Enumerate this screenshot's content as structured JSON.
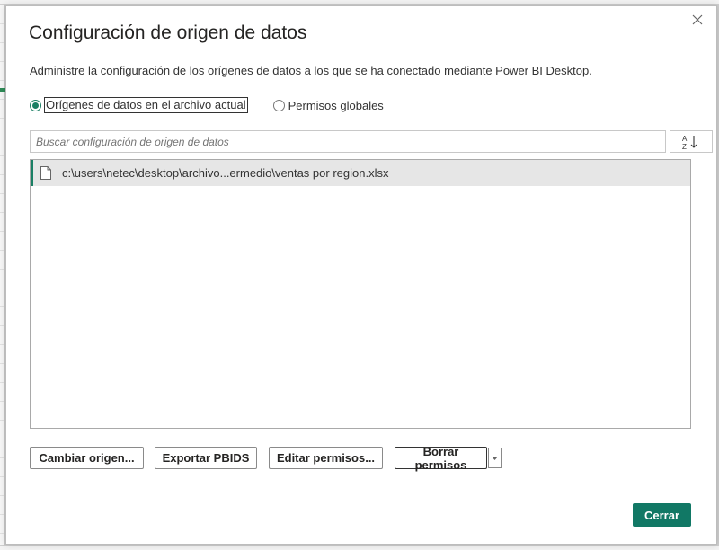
{
  "dialog": {
    "title": "Configuración de origen de datos",
    "description": "Administre la configuración de los orígenes de datos a los que se ha conectado mediante Power BI Desktop.",
    "close_icon": "close-icon"
  },
  "scope": {
    "options": [
      {
        "label": "Orígenes de datos en el archivo actual",
        "selected": true
      },
      {
        "label": "Permisos globales",
        "selected": false
      }
    ]
  },
  "search": {
    "placeholder": "Buscar configuración de origen de datos",
    "value": ""
  },
  "sort_icon": "sort-az-icon",
  "sources": [
    {
      "icon": "file-icon",
      "path": "c:\\users\\netec\\desktop\\archivo...ermedio\\ventas por region.xlsx",
      "selected": true
    }
  ],
  "actions": {
    "change_source": "Cambiar origen...",
    "export_pbids": "Exportar PBIDS",
    "edit_permissions": "Editar permisos...",
    "clear_permissions": "Borrar permisos",
    "close": "Cerrar"
  },
  "colors": {
    "accent": "#117865",
    "selection": "#e6e6e6"
  }
}
